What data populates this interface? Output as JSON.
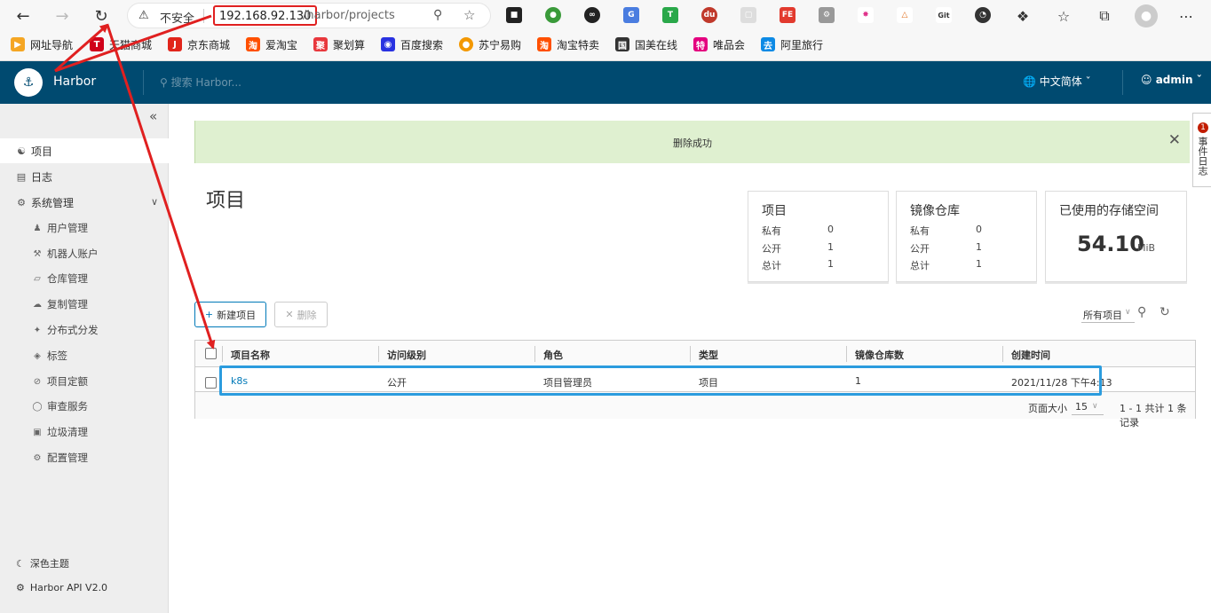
{
  "browser": {
    "insecure_label": "不安全",
    "host": "192.168.92.130",
    "path": "/harbor/projects"
  },
  "bookmarks": [
    {
      "label": "网址导航",
      "color": "#f5a623"
    },
    {
      "label": "天猫商城",
      "color": "#d0021b"
    },
    {
      "label": "京东商城",
      "color": "#e1251b"
    },
    {
      "label": "爱淘宝",
      "color": "#ff5000"
    },
    {
      "label": "聚划算",
      "color": "#e8383d"
    },
    {
      "label": "百度搜索",
      "color": "#2932e1"
    },
    {
      "label": "苏宁易购",
      "color": "#f39800"
    },
    {
      "label": "淘宝特卖",
      "color": "#ff5000"
    },
    {
      "label": "国美在线",
      "color": "#333333"
    },
    {
      "label": "唯品会",
      "color": "#e4007f"
    },
    {
      "label": "阿里旅行",
      "color": "#0d8ae5"
    }
  ],
  "header": {
    "brand": "Harbor",
    "search_placeholder": "搜索 Harbor...",
    "language": "中文简体",
    "user": "admin"
  },
  "sidebar": {
    "items": [
      {
        "label": "项目",
        "icon": "projects-icon"
      },
      {
        "label": "日志",
        "icon": "logs-icon"
      },
      {
        "label": "系统管理",
        "icon": "admin-icon"
      }
    ],
    "sub_items": [
      {
        "label": "用户管理"
      },
      {
        "label": "机器人账户"
      },
      {
        "label": "仓库管理"
      },
      {
        "label": "复制管理"
      },
      {
        "label": "分布式分发"
      },
      {
        "label": "标签"
      },
      {
        "label": "项目定额"
      },
      {
        "label": "审查服务"
      },
      {
        "label": "垃圾清理"
      },
      {
        "label": "配置管理"
      }
    ],
    "theme": "深色主题",
    "api": "Harbor API V2.0"
  },
  "toast": {
    "message": "删除成功"
  },
  "page": {
    "title": "项目"
  },
  "cards": {
    "projects": {
      "title": "项目",
      "private_label": "私有",
      "private": "0",
      "public_label": "公开",
      "public": "1",
      "total_label": "总计",
      "total": "1"
    },
    "repos": {
      "title": "镜像仓库",
      "private_label": "私有",
      "private": "0",
      "public_label": "公开",
      "public": "1",
      "total_label": "总计",
      "total": "1"
    },
    "storage": {
      "title": "已使用的存储空间",
      "value": "54.10",
      "unit": "MiB"
    }
  },
  "toolbar": {
    "new_label": "新建项目",
    "delete_label": "删除",
    "filter": "所有项目"
  },
  "table": {
    "headers": [
      "项目名称",
      "访问级别",
      "角色",
      "类型",
      "镜像仓库数",
      "创建时间"
    ],
    "rows": [
      {
        "name": "k8s",
        "access": "公开",
        "role": "项目管理员",
        "type": "项目",
        "repos": "1",
        "created": "2021/11/28 下午4:13"
      }
    ],
    "page_size_label": "页面大小",
    "page_size": "15",
    "count": "1 - 1 共计 1 条记录"
  },
  "event_log": {
    "badge": "1",
    "label": "事件日志"
  },
  "colors": {
    "header": "#004a70",
    "toast": "#dff0d0",
    "highlight": "#2b9cde",
    "annotation": "#e02020"
  }
}
